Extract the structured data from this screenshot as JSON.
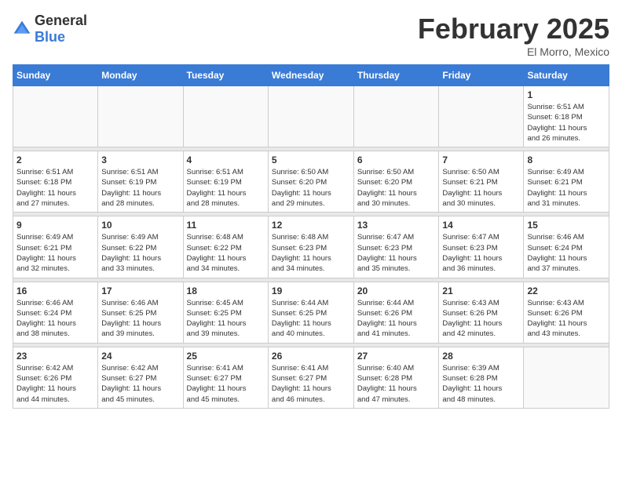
{
  "header": {
    "logo_general": "General",
    "logo_blue": "Blue",
    "month_year": "February 2025",
    "location": "El Morro, Mexico"
  },
  "weekdays": [
    "Sunday",
    "Monday",
    "Tuesday",
    "Wednesday",
    "Thursday",
    "Friday",
    "Saturday"
  ],
  "weeks": [
    [
      {
        "day": "",
        "info": ""
      },
      {
        "day": "",
        "info": ""
      },
      {
        "day": "",
        "info": ""
      },
      {
        "day": "",
        "info": ""
      },
      {
        "day": "",
        "info": ""
      },
      {
        "day": "",
        "info": ""
      },
      {
        "day": "1",
        "info": "Sunrise: 6:51 AM\nSunset: 6:18 PM\nDaylight: 11 hours\nand 26 minutes."
      }
    ],
    [
      {
        "day": "2",
        "info": "Sunrise: 6:51 AM\nSunset: 6:18 PM\nDaylight: 11 hours\nand 27 minutes."
      },
      {
        "day": "3",
        "info": "Sunrise: 6:51 AM\nSunset: 6:19 PM\nDaylight: 11 hours\nand 28 minutes."
      },
      {
        "day": "4",
        "info": "Sunrise: 6:51 AM\nSunset: 6:19 PM\nDaylight: 11 hours\nand 28 minutes."
      },
      {
        "day": "5",
        "info": "Sunrise: 6:50 AM\nSunset: 6:20 PM\nDaylight: 11 hours\nand 29 minutes."
      },
      {
        "day": "6",
        "info": "Sunrise: 6:50 AM\nSunset: 6:20 PM\nDaylight: 11 hours\nand 30 minutes."
      },
      {
        "day": "7",
        "info": "Sunrise: 6:50 AM\nSunset: 6:21 PM\nDaylight: 11 hours\nand 30 minutes."
      },
      {
        "day": "8",
        "info": "Sunrise: 6:49 AM\nSunset: 6:21 PM\nDaylight: 11 hours\nand 31 minutes."
      }
    ],
    [
      {
        "day": "9",
        "info": "Sunrise: 6:49 AM\nSunset: 6:21 PM\nDaylight: 11 hours\nand 32 minutes."
      },
      {
        "day": "10",
        "info": "Sunrise: 6:49 AM\nSunset: 6:22 PM\nDaylight: 11 hours\nand 33 minutes."
      },
      {
        "day": "11",
        "info": "Sunrise: 6:48 AM\nSunset: 6:22 PM\nDaylight: 11 hours\nand 34 minutes."
      },
      {
        "day": "12",
        "info": "Sunrise: 6:48 AM\nSunset: 6:23 PM\nDaylight: 11 hours\nand 34 minutes."
      },
      {
        "day": "13",
        "info": "Sunrise: 6:47 AM\nSunset: 6:23 PM\nDaylight: 11 hours\nand 35 minutes."
      },
      {
        "day": "14",
        "info": "Sunrise: 6:47 AM\nSunset: 6:23 PM\nDaylight: 11 hours\nand 36 minutes."
      },
      {
        "day": "15",
        "info": "Sunrise: 6:46 AM\nSunset: 6:24 PM\nDaylight: 11 hours\nand 37 minutes."
      }
    ],
    [
      {
        "day": "16",
        "info": "Sunrise: 6:46 AM\nSunset: 6:24 PM\nDaylight: 11 hours\nand 38 minutes."
      },
      {
        "day": "17",
        "info": "Sunrise: 6:46 AM\nSunset: 6:25 PM\nDaylight: 11 hours\nand 39 minutes."
      },
      {
        "day": "18",
        "info": "Sunrise: 6:45 AM\nSunset: 6:25 PM\nDaylight: 11 hours\nand 39 minutes."
      },
      {
        "day": "19",
        "info": "Sunrise: 6:44 AM\nSunset: 6:25 PM\nDaylight: 11 hours\nand 40 minutes."
      },
      {
        "day": "20",
        "info": "Sunrise: 6:44 AM\nSunset: 6:26 PM\nDaylight: 11 hours\nand 41 minutes."
      },
      {
        "day": "21",
        "info": "Sunrise: 6:43 AM\nSunset: 6:26 PM\nDaylight: 11 hours\nand 42 minutes."
      },
      {
        "day": "22",
        "info": "Sunrise: 6:43 AM\nSunset: 6:26 PM\nDaylight: 11 hours\nand 43 minutes."
      }
    ],
    [
      {
        "day": "23",
        "info": "Sunrise: 6:42 AM\nSunset: 6:26 PM\nDaylight: 11 hours\nand 44 minutes."
      },
      {
        "day": "24",
        "info": "Sunrise: 6:42 AM\nSunset: 6:27 PM\nDaylight: 11 hours\nand 45 minutes."
      },
      {
        "day": "25",
        "info": "Sunrise: 6:41 AM\nSunset: 6:27 PM\nDaylight: 11 hours\nand 45 minutes."
      },
      {
        "day": "26",
        "info": "Sunrise: 6:41 AM\nSunset: 6:27 PM\nDaylight: 11 hours\nand 46 minutes."
      },
      {
        "day": "27",
        "info": "Sunrise: 6:40 AM\nSunset: 6:28 PM\nDaylight: 11 hours\nand 47 minutes."
      },
      {
        "day": "28",
        "info": "Sunrise: 6:39 AM\nSunset: 6:28 PM\nDaylight: 11 hours\nand 48 minutes."
      },
      {
        "day": "",
        "info": ""
      }
    ]
  ]
}
